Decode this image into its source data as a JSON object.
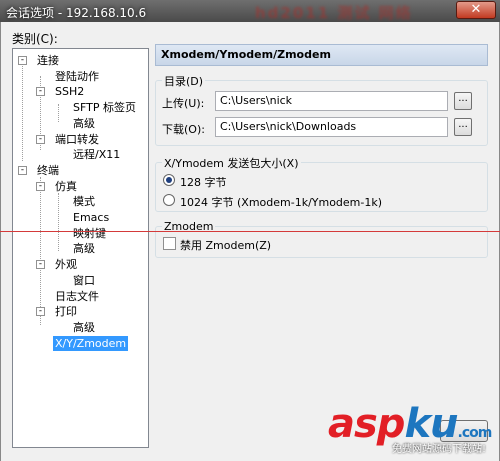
{
  "window": {
    "title": "会话选项 - 192.168.10.6",
    "blurred_banner": "hd2011 测试 网络",
    "close_glyph": "✕"
  },
  "category_label": "类别(C):",
  "tree": [
    {
      "label": "连接",
      "level": 0,
      "expander": "-"
    },
    {
      "label": "登陆动作",
      "level": 1
    },
    {
      "label": "SSH2",
      "level": 1,
      "expander": "-"
    },
    {
      "label": "SFTP 标签页",
      "level": 2
    },
    {
      "label": "高级",
      "level": 2
    },
    {
      "label": "端口转发",
      "level": 1,
      "expander": "-"
    },
    {
      "label": "远程/X11",
      "level": 2
    },
    {
      "label": "终端",
      "level": 0,
      "expander": "-"
    },
    {
      "label": "仿真",
      "level": 1,
      "expander": "-"
    },
    {
      "label": "模式",
      "level": 2
    },
    {
      "label": "Emacs",
      "level": 2
    },
    {
      "label": "映射键",
      "level": 2
    },
    {
      "label": "高级",
      "level": 2
    },
    {
      "label": "外观",
      "level": 1,
      "expander": "-"
    },
    {
      "label": "窗口",
      "level": 2
    },
    {
      "label": "日志文件",
      "level": 1
    },
    {
      "label": "打印",
      "level": 1,
      "expander": "-"
    },
    {
      "label": "高级",
      "level": 2
    },
    {
      "label": "X/Y/Zmodem",
      "level": 1,
      "selected": true
    }
  ],
  "panel": {
    "header": "Xmodem/Ymodem/Zmodem",
    "dir_group": {
      "label": "目录(D)",
      "upload_label": "上传(U):",
      "upload_value": "C:\\Users\\nick",
      "download_label": "下载(O):",
      "download_value": "C:\\Users\\nick\\Downloads",
      "browse_label": "..."
    },
    "xy_group": {
      "label": "X/Ymodem 发送包大小(X)",
      "option_128": "128 字节",
      "option_1024": "1024 字节  (Xmodem-1k/Ymodem-1k)",
      "selected": "128"
    },
    "z_group": {
      "label": "Zmodem",
      "disable_label": "禁用 Zmodem(Z)",
      "disable_checked": false
    }
  },
  "watermark": {
    "asp": "asp",
    "ku": "ku",
    "com": ".com",
    "sub": "免费网站源码下载站!"
  },
  "colors": {
    "selection": "#3399ff",
    "header_bg": "#dfe8f4",
    "annotation_line": "#d43a3a",
    "watermark_red": "#e21f26",
    "watermark_blue": "#1d76bf"
  }
}
